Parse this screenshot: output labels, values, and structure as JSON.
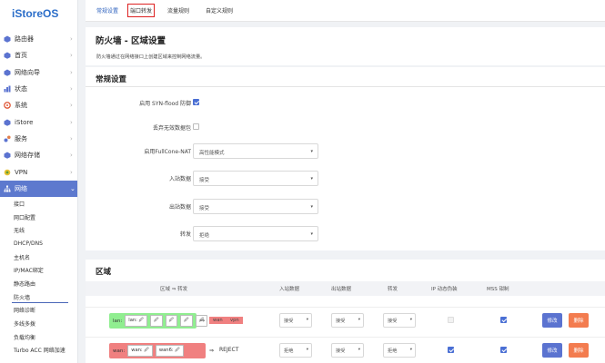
{
  "app": {
    "logo": "iStoreOS"
  },
  "sidebar": {
    "items": [
      {
        "label": "路由器",
        "icon": "router-icon"
      },
      {
        "label": "首页",
        "icon": "home-icon"
      },
      {
        "label": "网络向导",
        "icon": "wizard-icon"
      },
      {
        "label": "状态",
        "icon": "status-icon"
      },
      {
        "label": "系统",
        "icon": "gear-icon"
      },
      {
        "label": "iStore",
        "icon": "store-icon"
      },
      {
        "label": "服务",
        "icon": "services-icon"
      },
      {
        "label": "网络存储",
        "icon": "storage-icon"
      },
      {
        "label": "VPN",
        "icon": "vpn-icon"
      },
      {
        "label": "网络",
        "icon": "network-icon"
      }
    ],
    "network_sub": [
      "接口",
      "网口配置",
      "无线",
      "DHCP/DNS",
      "主机名",
      "IP/MAC绑定",
      "静态路由",
      "防火墙",
      "网络诊断",
      "多线多拨",
      "负载均衡",
      "Turbo ACC 网络加速"
    ]
  },
  "tabs": [
    "常规设置",
    "端口转发",
    "流量规则",
    "自定义规则"
  ],
  "page": {
    "title": "防火墙 - 区域设置",
    "description": "防火墙通过在网络接口上创建区域来控制网络流量。"
  },
  "general": {
    "title": "常规设置",
    "syn_flood_label": "启用 SYN-flood 防御",
    "drop_invalid_label": "丢弃无效数据包",
    "fullcone_label": "启用FullCone-NAT",
    "fullcone_value": "高性能模式",
    "input_label": "入站数据",
    "input_value": "接受",
    "output_label": "出站数据",
    "output_value": "接受",
    "forward_label": "转发",
    "forward_value": "拒绝"
  },
  "zones": {
    "title": "区域",
    "headers": {
      "zone": "区域 ⇒ 转发",
      "input": "入站数据",
      "output": "出站数据",
      "forward": "转发",
      "masq": "IP 动态伪装",
      "mss": "MSS 钳制"
    },
    "rows": [
      {
        "zone_name": "lan:",
        "zone_color": "#90ee90",
        "devices": [
          "lan: 🖉",
          "🖉",
          "🖉",
          "🖉",
          "🖉"
        ],
        "targets": [
          "wan",
          "vpn"
        ],
        "input": "接受",
        "output": "接受",
        "forward": "接受",
        "masq": false,
        "mss": true,
        "edit": "修改",
        "delete": "删除"
      },
      {
        "zone_name": "wan:",
        "zone_color": "#f08080",
        "devices": [
          "wan: 🖉",
          "wan6: 🖉"
        ],
        "reject": "REJECT",
        "input": "拒绝",
        "output": "接受",
        "forward": "拒绝",
        "masq": true,
        "mss": true,
        "edit": "修改",
        "delete": "删除"
      }
    ]
  }
}
